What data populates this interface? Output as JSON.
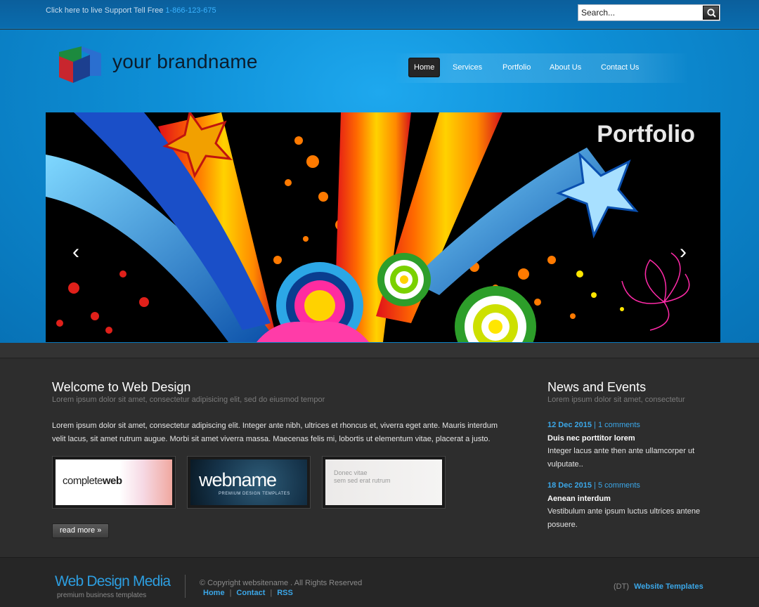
{
  "topbar": {
    "support_text": "Click here to live Support Tell Free",
    "phone": "1-866-123-675",
    "search_placeholder": "Search..."
  },
  "header": {
    "brand": "your brandname",
    "nav": [
      "Home",
      "Services",
      "Portfolio",
      "About Us",
      "Contact Us"
    ],
    "active_nav": "Home"
  },
  "slider": {
    "title": "Portfolio",
    "prev_glyph": "‹",
    "next_glyph": "›"
  },
  "welcome": {
    "title": "Welcome to Web Design",
    "subtitle": "Lorem ipsum dolor sit amet, consectetur adipisicing elit, sed do eiusmod tempor",
    "body": "Lorem ipsum dolor sit amet, consectetur adipiscing elit. Integer ante nibh, ultrices et rhoncus et, viverra eget ante. Mauris interdum velit lacus, sit amet rutrum augue. Morbi sit amet viverra massa. Maecenas felis mi, lobortis ut elementum vitae, placerat a justo.",
    "thumbs": [
      {
        "label_a": "complete",
        "label_b": "web"
      },
      {
        "label_a": "webname",
        "label_b": "PREMIUM DESIGN TEMPLATES"
      },
      {
        "label_a": "Donec vitae",
        "label_b": "sem sed erat rutrum"
      }
    ],
    "read_more": "read more »"
  },
  "news": {
    "title": "News and Events",
    "subtitle": "Lorem ipsum dolor sit amet, consectetur",
    "items": [
      {
        "date": "12 Dec 2015",
        "comments": "1 comments",
        "headline": "Duis nec porttitor lorem",
        "text": "Integer lacus ante then ante ullamcorper ut vulputate.."
      },
      {
        "date": "18 Dec 2015",
        "comments": "5 comments",
        "headline": "Aenean interdum",
        "text": "Vestibulum ante ipsum luctus ultrices antene posuere."
      }
    ]
  },
  "footer": {
    "brand": "Web Design Media",
    "tagline": "premium business templates",
    "copyright": "© Copyright websitename . All Rights Reserved",
    "links": [
      "Home",
      "Contact",
      "RSS"
    ],
    "dt": "(DT)",
    "templates_link": "Website Templates"
  },
  "colors": {
    "accent": "#3ba7e8",
    "header_blue": "#0e8fd6",
    "body_bg": "#2d2d2d"
  }
}
